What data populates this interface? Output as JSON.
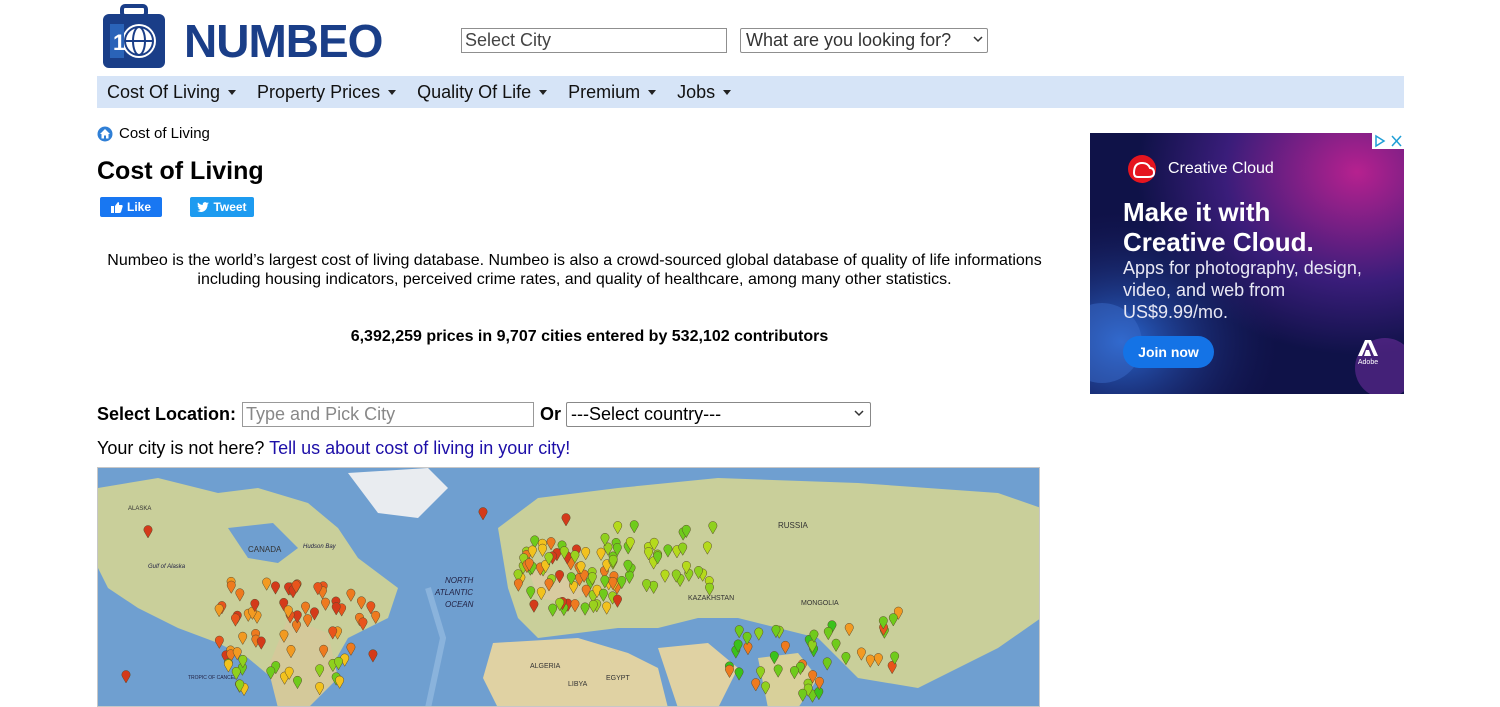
{
  "logo": {
    "text": "NUMBEO",
    "brand_color": "#1a3e88"
  },
  "search": {
    "city_placeholder": "Select City",
    "looking_for": "What are you looking for?"
  },
  "nav": {
    "background": "#d6e4f7",
    "items": [
      "Cost Of Living",
      "Property Prices",
      "Quality Of Life",
      "Premium",
      "Jobs"
    ]
  },
  "breadcrumb": {
    "label": "Cost of Living"
  },
  "page": {
    "title": "Cost of Living"
  },
  "social": {
    "like": "Like",
    "tweet": "Tweet"
  },
  "intro": "Numbeo is the world’s largest cost of living database. Numbeo is also a crowd-sourced global database of quality of life informations including housing indicators, perceived crime rates, and quality of healthcare, among many other statistics.",
  "stats": "6,392,259 prices in 9,707 cities entered by 532,102 contributors",
  "location": {
    "label": "Select Location:",
    "input_placeholder": "Type and Pick City",
    "or": "Or",
    "country_select": "---Select country---"
  },
  "notice": {
    "prefix": "Your city is not here?",
    "link": "Tell us about cost of living in your city!"
  },
  "map": {
    "labels": [
      "ALASKA",
      "CANADA",
      "Hudson Bay",
      "NORTH",
      "ATLANTIC",
      "OCEAN",
      "RUSSIA",
      "KAZAKHSTAN",
      "MONGOLIA",
      "ALGERIA",
      "LIBYA",
      "EGYPT",
      "Gulf of Alaska",
      "TROPIC OF CANCER"
    ]
  },
  "ad": {
    "brand": "Creative Cloud",
    "headline_1": "Make it with",
    "headline_2": "Creative Cloud.",
    "subtext": "Apps for photography, design, video, and web from US$9.99/mo.",
    "button": "Join now",
    "adobe": "Adobe"
  }
}
